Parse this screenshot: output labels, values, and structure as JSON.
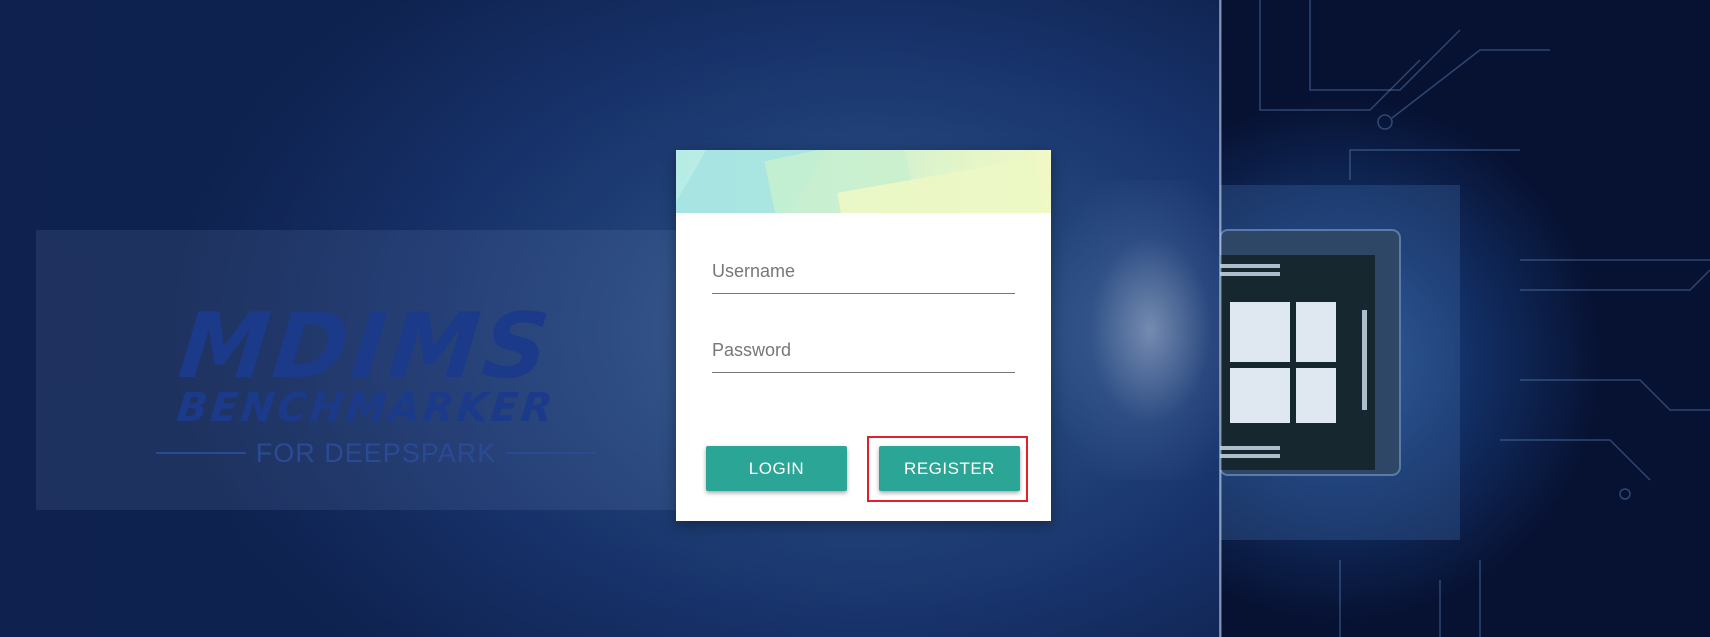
{
  "branding": {
    "title": "MDIMS",
    "subtitle": "BENCHMARKER",
    "tagline": "FOR DEEPSPARK"
  },
  "login_form": {
    "username_placeholder": "Username",
    "password_placeholder": "Password",
    "username_value": "",
    "password_value": "",
    "login_label": "LOGIN",
    "register_label": "REGISTER"
  },
  "colors": {
    "button": "#2aa596",
    "highlight": "#e0202a",
    "background": "#17326a"
  }
}
